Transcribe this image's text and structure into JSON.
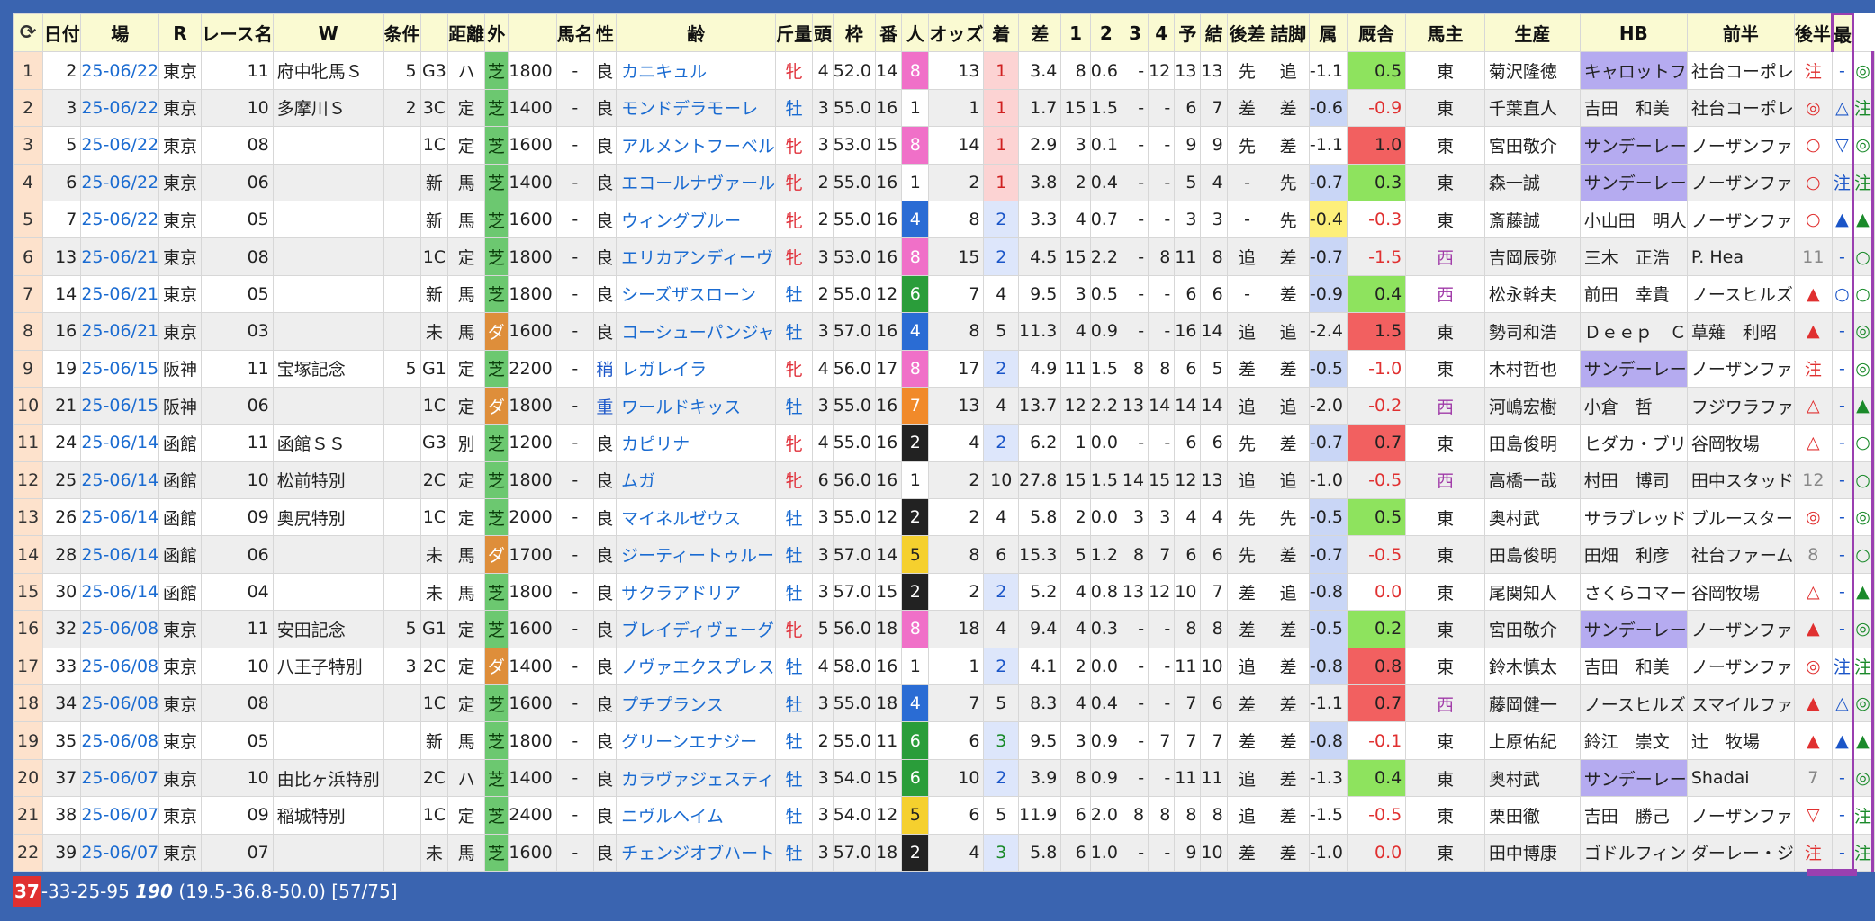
{
  "header": {
    "refresh_icon": "refresh-icon",
    "cols": [
      "日付",
      "場",
      "R",
      "レース名",
      "W",
      "条件",
      "",
      "距離",
      "外",
      "",
      "馬名",
      "性",
      "齢",
      "斤量",
      "頭",
      "枠",
      "番",
      "人",
      "オッズ",
      "着",
      "差",
      "1",
      "2",
      "3",
      "4",
      "予",
      "結",
      "後差",
      "詰脚",
      "属",
      "厩舎",
      "馬主",
      "生産",
      "HB",
      "前半",
      "後半",
      "最"
    ]
  },
  "status": {
    "highlight": "37",
    "rest": "-33-25-95",
    "bold": "190",
    "detail": "(19.5-36.8-50.0) [57/75]"
  },
  "rows": [
    [
      "1",
      "2",
      "25-06/22",
      "東京",
      "11",
      "府中牝馬Ｓ",
      "5",
      "G3",
      "ハ",
      "芝",
      "1800",
      "-",
      "良",
      "カニキュル",
      "牝",
      "4",
      "52.0",
      "14",
      "8",
      "13",
      "1",
      "3.4",
      "8",
      "0.6",
      "-",
      "12",
      "13",
      "13",
      "先",
      "追",
      "-1.1",
      "0.5",
      "東",
      "菊沢隆徳",
      "キャロットフ",
      "社台コーポレ",
      "注",
      "-",
      "◎",
      ""
    ],
    [
      "2",
      "3",
      "25-06/22",
      "東京",
      "10",
      "多摩川Ｓ",
      "2",
      "3C",
      "定",
      "芝",
      "1400",
      "-",
      "良",
      "モンドデラモーレ",
      "牡",
      "3",
      "55.0",
      "16",
      "1",
      "1",
      "1",
      "1.7",
      "15",
      "1.5",
      "-",
      "-",
      "6",
      "7",
      "差",
      "差",
      "-0.6",
      "-0.9",
      "東",
      "千葉直人",
      "吉田　和美",
      "社台コーポレ",
      "◎",
      "△",
      "注",
      ""
    ],
    [
      "3",
      "5",
      "25-06/22",
      "東京",
      "08",
      "",
      "",
      "1C",
      "定",
      "芝",
      "1600",
      "-",
      "良",
      "アルメントフーベル",
      "牝",
      "3",
      "53.0",
      "15",
      "8",
      "14",
      "1",
      "2.9",
      "3",
      "0.1",
      "-",
      "-",
      "9",
      "9",
      "先",
      "差",
      "-1.1",
      "1.0",
      "東",
      "宮田敬介",
      "サンデーレー",
      "ノーザンファ",
      "○",
      "▽",
      "◎",
      ""
    ],
    [
      "4",
      "6",
      "25-06/22",
      "東京",
      "06",
      "",
      "",
      "新",
      "馬",
      "芝",
      "1400",
      "-",
      "良",
      "エコールナヴァール",
      "牝",
      "2",
      "55.0",
      "16",
      "1",
      "2",
      "1",
      "3.8",
      "2",
      "0.4",
      "-",
      "-",
      "5",
      "4",
      "-",
      "先",
      "-0.7",
      "0.3",
      "東",
      "森一誠",
      "サンデーレー",
      "ノーザンファ",
      "○",
      "注",
      "注",
      ""
    ],
    [
      "5",
      "7",
      "25-06/22",
      "東京",
      "05",
      "",
      "",
      "新",
      "馬",
      "芝",
      "1600",
      "-",
      "良",
      "ウィングブルー",
      "牝",
      "2",
      "55.0",
      "16",
      "4",
      "8",
      "2",
      "3.3",
      "4",
      "0.7",
      "-",
      "-",
      "3",
      "3",
      "-",
      "先",
      "-0.4",
      "-0.3",
      "東",
      "斎藤誠",
      "小山田　明人",
      "ノーザンファ",
      "○",
      "▲",
      "▲",
      ""
    ],
    [
      "6",
      "13",
      "25-06/21",
      "東京",
      "08",
      "",
      "",
      "1C",
      "定",
      "芝",
      "1800",
      "-",
      "良",
      "エリカアンディーヴ",
      "牝",
      "3",
      "53.0",
      "16",
      "8",
      "15",
      "2",
      "4.5",
      "15",
      "2.2",
      "-",
      "8",
      "11",
      "8",
      "追",
      "差",
      "-0.7",
      "-1.5",
      "西",
      "吉岡辰弥",
      "三木　正浩",
      "P. Hea",
      "11",
      "-",
      "○",
      ""
    ],
    [
      "7",
      "14",
      "25-06/21",
      "東京",
      "05",
      "",
      "",
      "新",
      "馬",
      "芝",
      "1800",
      "-",
      "良",
      "シーズザスローン",
      "牡",
      "2",
      "55.0",
      "12",
      "6",
      "7",
      "4",
      "9.5",
      "3",
      "0.5",
      "-",
      "-",
      "6",
      "6",
      "-",
      "差",
      "-0.9",
      "0.4",
      "西",
      "松永幹夫",
      "前田　幸貴",
      "ノースヒルズ",
      "▲",
      "○",
      "○",
      ""
    ],
    [
      "8",
      "16",
      "25-06/21",
      "東京",
      "03",
      "",
      "",
      "未",
      "馬",
      "ダ",
      "1600",
      "-",
      "良",
      "コーシューパンジャ",
      "牡",
      "3",
      "57.0",
      "16",
      "4",
      "8",
      "5",
      "11.3",
      "4",
      "0.9",
      "-",
      "-",
      "16",
      "14",
      "追",
      "追",
      "-2.4",
      "1.5",
      "東",
      "勢司和浩",
      "Ｄｅｅｐ　Ｃ",
      "草薙　利昭",
      "▲",
      "-",
      "◎",
      ""
    ],
    [
      "9",
      "19",
      "25-06/15",
      "阪神",
      "11",
      "宝塚記念",
      "5",
      "G1",
      "定",
      "芝",
      "2200",
      "-",
      "稍",
      "レガレイラ",
      "牝",
      "4",
      "56.0",
      "17",
      "8",
      "17",
      "2",
      "4.9",
      "11",
      "1.5",
      "8",
      "8",
      "6",
      "5",
      "差",
      "差",
      "-0.5",
      "-1.0",
      "東",
      "木村哲也",
      "サンデーレー",
      "ノーザンファ",
      "注",
      "-",
      "◎",
      ""
    ],
    [
      "10",
      "21",
      "25-06/15",
      "阪神",
      "06",
      "",
      "",
      "1C",
      "定",
      "ダ",
      "1800",
      "-",
      "重",
      "ワールドキッス",
      "牡",
      "3",
      "55.0",
      "16",
      "7",
      "13",
      "4",
      "13.7",
      "12",
      "2.2",
      "13",
      "14",
      "14",
      "14",
      "追",
      "追",
      "-2.0",
      "-0.2",
      "西",
      "河嶋宏樹",
      "小倉　哲",
      "フジワラファ",
      "△",
      "-",
      "▲",
      ""
    ],
    [
      "11",
      "24",
      "25-06/14",
      "函館",
      "11",
      "函館ＳＳ",
      "",
      "G3",
      "別",
      "芝",
      "1200",
      "-",
      "良",
      "カピリナ",
      "牝",
      "4",
      "55.0",
      "16",
      "2",
      "4",
      "2",
      "6.2",
      "1",
      "0.0",
      "-",
      "-",
      "6",
      "6",
      "先",
      "差",
      "-0.7",
      "0.7",
      "東",
      "田島俊明",
      "ヒダカ・ブリ",
      "谷岡牧場",
      "△",
      "-",
      "○",
      ""
    ],
    [
      "12",
      "25",
      "25-06/14",
      "函館",
      "10",
      "松前特別",
      "",
      "2C",
      "定",
      "芝",
      "1800",
      "-",
      "良",
      "ムガ",
      "牝",
      "6",
      "56.0",
      "16",
      "1",
      "2",
      "10",
      "27.8",
      "15",
      "1.5",
      "14",
      "15",
      "12",
      "13",
      "追",
      "追",
      "-1.0",
      "-0.5",
      "西",
      "高橋一哉",
      "村田　博司",
      "田中スタッド",
      "12",
      "-",
      "○",
      ""
    ],
    [
      "13",
      "26",
      "25-06/14",
      "函館",
      "09",
      "奥尻特別",
      "",
      "1C",
      "定",
      "芝",
      "2000",
      "-",
      "良",
      "マイネルゼウス",
      "牡",
      "3",
      "55.0",
      "12",
      "2",
      "2",
      "4",
      "5.8",
      "2",
      "0.0",
      "3",
      "3",
      "4",
      "4",
      "先",
      "先",
      "-0.5",
      "0.5",
      "東",
      "奥村武",
      "サラブレッド",
      "ブルースター",
      "◎",
      "-",
      "◎",
      ""
    ],
    [
      "14",
      "28",
      "25-06/14",
      "函館",
      "06",
      "",
      "",
      "未",
      "馬",
      "ダ",
      "1700",
      "-",
      "良",
      "ジーティートゥルー",
      "牡",
      "3",
      "57.0",
      "14",
      "5",
      "8",
      "6",
      "15.3",
      "5",
      "1.2",
      "8",
      "7",
      "6",
      "6",
      "先",
      "差",
      "-0.7",
      "-0.5",
      "東",
      "田島俊明",
      "田畑　利彦",
      "社台ファーム",
      "8",
      "-",
      "○",
      ""
    ],
    [
      "15",
      "30",
      "25-06/14",
      "函館",
      "04",
      "",
      "",
      "未",
      "馬",
      "芝",
      "1800",
      "-",
      "良",
      "サクラアドリア",
      "牡",
      "3",
      "57.0",
      "15",
      "2",
      "2",
      "2",
      "5.2",
      "4",
      "0.8",
      "13",
      "12",
      "10",
      "7",
      "差",
      "追",
      "-0.8",
      "0.0",
      "東",
      "尾関知人",
      "さくらコマー",
      "谷岡牧場",
      "△",
      "-",
      "▲",
      ""
    ],
    [
      "16",
      "32",
      "25-06/08",
      "東京",
      "11",
      "安田記念",
      "5",
      "G1",
      "定",
      "芝",
      "1600",
      "-",
      "良",
      "ブレイディヴェーグ",
      "牝",
      "5",
      "56.0",
      "18",
      "8",
      "18",
      "4",
      "9.4",
      "4",
      "0.3",
      "-",
      "-",
      "8",
      "8",
      "差",
      "差",
      "-0.5",
      "0.2",
      "東",
      "宮田敬介",
      "サンデーレー",
      "ノーザンファ",
      "▲",
      "-",
      "◎",
      ""
    ],
    [
      "17",
      "33",
      "25-06/08",
      "東京",
      "10",
      "八王子特別",
      "3",
      "2C",
      "定",
      "ダ",
      "1400",
      "-",
      "良",
      "ノヴァエクスプレス",
      "牡",
      "4",
      "58.0",
      "16",
      "1",
      "1",
      "2",
      "4.1",
      "2",
      "0.0",
      "-",
      "-",
      "11",
      "10",
      "追",
      "差",
      "-0.8",
      "0.8",
      "東",
      "鈴木慎太",
      "吉田　和美",
      "ノーザンファ",
      "◎",
      "注",
      "注",
      ""
    ],
    [
      "18",
      "34",
      "25-06/08",
      "東京",
      "08",
      "",
      "",
      "1C",
      "定",
      "芝",
      "1600",
      "-",
      "良",
      "プチプランス",
      "牡",
      "3",
      "55.0",
      "18",
      "4",
      "7",
      "5",
      "8.3",
      "4",
      "0.4",
      "-",
      "-",
      "7",
      "6",
      "差",
      "差",
      "-1.1",
      "0.7",
      "西",
      "藤岡健一",
      "ノースヒルズ",
      "スマイルファ",
      "▲",
      "△",
      "◎",
      ""
    ],
    [
      "19",
      "35",
      "25-06/08",
      "東京",
      "05",
      "",
      "",
      "新",
      "馬",
      "芝",
      "1800",
      "-",
      "良",
      "グリーンエナジー",
      "牡",
      "2",
      "55.0",
      "11",
      "6",
      "6",
      "3",
      "9.5",
      "3",
      "0.9",
      "-",
      "7",
      "7",
      "7",
      "差",
      "差",
      "-0.8",
      "-0.1",
      "東",
      "上原佑紀",
      "鈴江　崇文",
      "辻　牧場",
      "▲",
      "▲",
      "▲",
      ""
    ],
    [
      "20",
      "37",
      "25-06/07",
      "東京",
      "10",
      "由比ヶ浜特別",
      "",
      "2C",
      "ハ",
      "芝",
      "1400",
      "-",
      "良",
      "カラヴァジェスティ",
      "牡",
      "3",
      "54.0",
      "15",
      "6",
      "10",
      "2",
      "3.9",
      "8",
      "0.9",
      "-",
      "-",
      "11",
      "11",
      "追",
      "差",
      "-1.3",
      "0.4",
      "東",
      "奥村武",
      "サンデーレー",
      "Shadai",
      "7",
      "-",
      "◎",
      ""
    ],
    [
      "21",
      "38",
      "25-06/07",
      "東京",
      "09",
      "稲城特別",
      "",
      "1C",
      "定",
      "芝",
      "2400",
      "-",
      "良",
      "ニヴルヘイム",
      "牡",
      "3",
      "54.0",
      "12",
      "5",
      "6",
      "5",
      "11.9",
      "6",
      "2.0",
      "8",
      "8",
      "8",
      "8",
      "追",
      "差",
      "-1.5",
      "-0.5",
      "東",
      "栗田徹",
      "吉田　勝己",
      "ノーザンファ",
      "▽",
      "-",
      "注",
      ""
    ],
    [
      "22",
      "39",
      "25-06/07",
      "東京",
      "07",
      "",
      "",
      "未",
      "馬",
      "芝",
      "1600",
      "-",
      "良",
      "チェンジオブハート",
      "牡",
      "3",
      "57.0",
      "18",
      "2",
      "4",
      "3",
      "5.8",
      "6",
      "1.0",
      "-",
      "-",
      "9",
      "10",
      "差",
      "差",
      "-1.0",
      "0.0",
      "東",
      "田中博康",
      "ゴドルフィン",
      "ダーレー・ジ",
      "注",
      "-",
      "注",
      ""
    ]
  ]
}
